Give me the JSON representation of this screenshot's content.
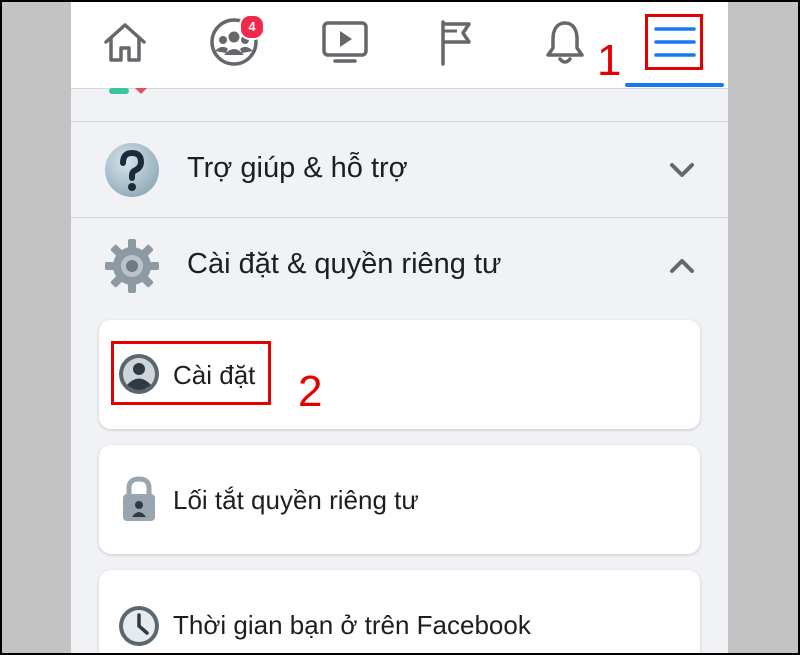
{
  "nav": {
    "items": [
      {
        "name": "home",
        "icon": "home-icon"
      },
      {
        "name": "groups",
        "icon": "groups-icon",
        "badge": "4"
      },
      {
        "name": "watch",
        "icon": "video-play-icon"
      },
      {
        "name": "pages",
        "icon": "flag-icon"
      },
      {
        "name": "notifications",
        "icon": "bell-icon"
      },
      {
        "name": "menu",
        "icon": "hamburger-menu-icon",
        "active": true
      }
    ],
    "accent_color": "#1877f2",
    "badge_color": "#f02849"
  },
  "menu": {
    "help": {
      "label": "Trợ giúp & hỗ trợ",
      "icon": "question-icon",
      "expanded": false
    },
    "settings_privacy": {
      "label": "Cài đặt & quyền riêng tư",
      "icon": "gear-icon",
      "expanded": true,
      "items": [
        {
          "label": "Cài đặt",
          "icon": "user-icon"
        },
        {
          "label": "Lối tắt quyền riêng tư",
          "icon": "lock-icon"
        },
        {
          "label": "Thời gian bạn ở trên Facebook",
          "icon": "clock-icon"
        }
      ]
    }
  },
  "annotations": {
    "step1": "1",
    "step2": "2",
    "color": "#e50000"
  }
}
